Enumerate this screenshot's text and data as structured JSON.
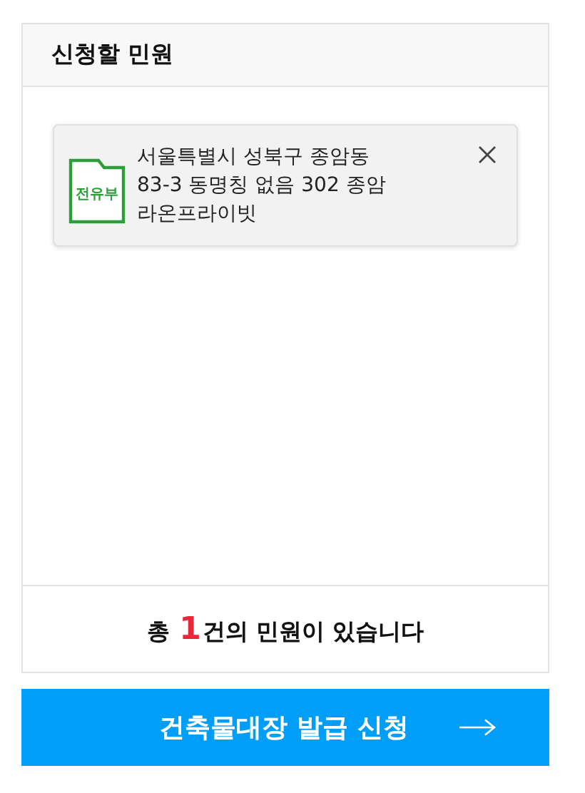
{
  "panel": {
    "title": "신청할 민원"
  },
  "items": [
    {
      "tag": "전유부",
      "address": "서울특별시 성북구 종암동 83-3 동명칭 없음 302 종암 라온프라이빗"
    }
  ],
  "summary": {
    "prefix": "총 ",
    "count": "1",
    "suffix": "건의 민원이 있습니다"
  },
  "submit_button": {
    "label": "건축물대장 발급 신청"
  }
}
